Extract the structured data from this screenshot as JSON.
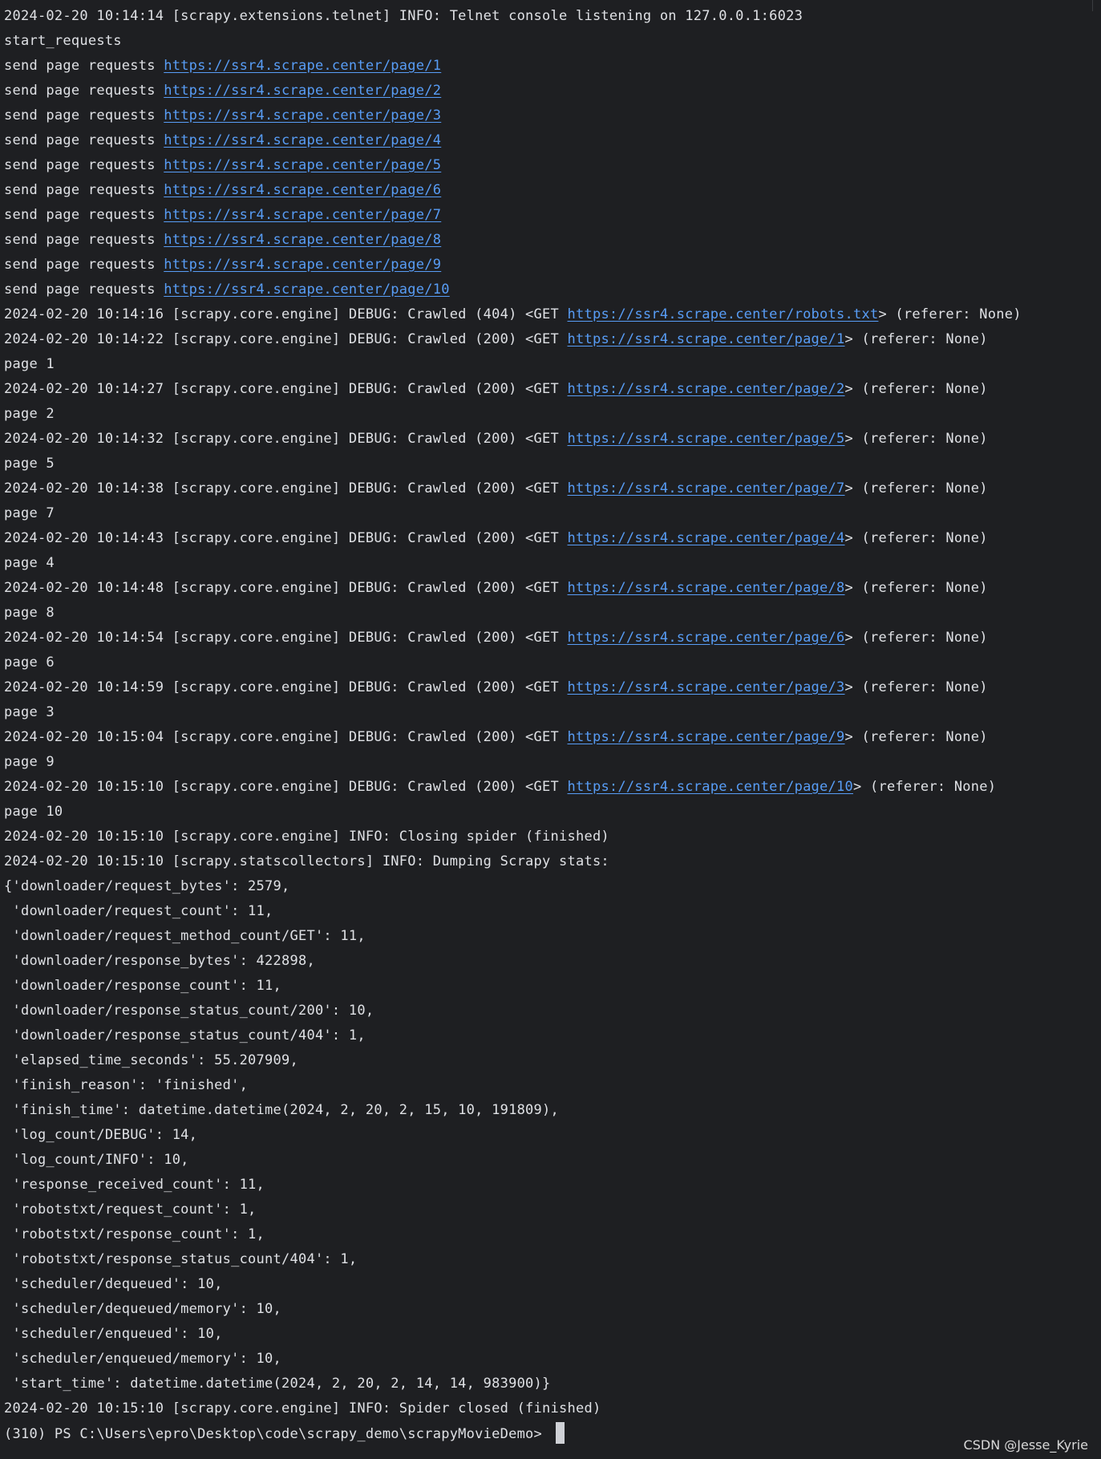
{
  "terminal": {
    "lines": [
      [
        {
          "t": "2024-02-20 10:14:14 [scrapy.extensions.telnet] INFO: Telnet console listening on 127.0.0.1:6023"
        }
      ],
      [
        {
          "t": "start_requests"
        }
      ],
      [
        {
          "t": "send page requests "
        },
        {
          "t": "https://ssr4.scrape.center/page/1",
          "link": true
        }
      ],
      [
        {
          "t": "send page requests "
        },
        {
          "t": "https://ssr4.scrape.center/page/2",
          "link": true
        }
      ],
      [
        {
          "t": "send page requests "
        },
        {
          "t": "https://ssr4.scrape.center/page/3",
          "link": true
        }
      ],
      [
        {
          "t": "send page requests "
        },
        {
          "t": "https://ssr4.scrape.center/page/4",
          "link": true
        }
      ],
      [
        {
          "t": "send page requests "
        },
        {
          "t": "https://ssr4.scrape.center/page/5",
          "link": true
        }
      ],
      [
        {
          "t": "send page requests "
        },
        {
          "t": "https://ssr4.scrape.center/page/6",
          "link": true
        }
      ],
      [
        {
          "t": "send page requests "
        },
        {
          "t": "https://ssr4.scrape.center/page/7",
          "link": true
        }
      ],
      [
        {
          "t": "send page requests "
        },
        {
          "t": "https://ssr4.scrape.center/page/8",
          "link": true
        }
      ],
      [
        {
          "t": "send page requests "
        },
        {
          "t": "https://ssr4.scrape.center/page/9",
          "link": true
        }
      ],
      [
        {
          "t": "send page requests "
        },
        {
          "t": "https://ssr4.scrape.center/page/10",
          "link": true
        }
      ],
      [
        {
          "t": "2024-02-20 10:14:16 [scrapy.core.engine] DEBUG: Crawled (404) <GET "
        },
        {
          "t": "https://ssr4.scrape.center/robots.txt",
          "link": true
        },
        {
          "t": "> (referer: None)"
        }
      ],
      [
        {
          "t": "2024-02-20 10:14:22 [scrapy.core.engine] DEBUG: Crawled (200) <GET "
        },
        {
          "t": "https://ssr4.scrape.center/page/1",
          "link": true
        },
        {
          "t": "> (referer: None)"
        }
      ],
      [
        {
          "t": "page 1"
        }
      ],
      [
        {
          "t": "2024-02-20 10:14:27 [scrapy.core.engine] DEBUG: Crawled (200) <GET "
        },
        {
          "t": "https://ssr4.scrape.center/page/2",
          "link": true
        },
        {
          "t": "> (referer: None)"
        }
      ],
      [
        {
          "t": "page 2"
        }
      ],
      [
        {
          "t": "2024-02-20 10:14:32 [scrapy.core.engine] DEBUG: Crawled (200) <GET "
        },
        {
          "t": "https://ssr4.scrape.center/page/5",
          "link": true
        },
        {
          "t": "> (referer: None)"
        }
      ],
      [
        {
          "t": "page 5"
        }
      ],
      [
        {
          "t": "2024-02-20 10:14:38 [scrapy.core.engine] DEBUG: Crawled (200) <GET "
        },
        {
          "t": "https://ssr4.scrape.center/page/7",
          "link": true
        },
        {
          "t": "> (referer: None)"
        }
      ],
      [
        {
          "t": "page 7"
        }
      ],
      [
        {
          "t": "2024-02-20 10:14:43 [scrapy.core.engine] DEBUG: Crawled (200) <GET "
        },
        {
          "t": "https://ssr4.scrape.center/page/4",
          "link": true
        },
        {
          "t": "> (referer: None)"
        }
      ],
      [
        {
          "t": "page 4"
        }
      ],
      [
        {
          "t": "2024-02-20 10:14:48 [scrapy.core.engine] DEBUG: Crawled (200) <GET "
        },
        {
          "t": "https://ssr4.scrape.center/page/8",
          "link": true
        },
        {
          "t": "> (referer: None)"
        }
      ],
      [
        {
          "t": "page 8"
        }
      ],
      [
        {
          "t": "2024-02-20 10:14:54 [scrapy.core.engine] DEBUG: Crawled (200) <GET "
        },
        {
          "t": "https://ssr4.scrape.center/page/6",
          "link": true
        },
        {
          "t": "> (referer: None)"
        }
      ],
      [
        {
          "t": "page 6"
        }
      ],
      [
        {
          "t": "2024-02-20 10:14:59 [scrapy.core.engine] DEBUG: Crawled (200) <GET "
        },
        {
          "t": "https://ssr4.scrape.center/page/3",
          "link": true
        },
        {
          "t": "> (referer: None)"
        }
      ],
      [
        {
          "t": "page 3"
        }
      ],
      [
        {
          "t": "2024-02-20 10:15:04 [scrapy.core.engine] DEBUG: Crawled (200) <GET "
        },
        {
          "t": "https://ssr4.scrape.center/page/9",
          "link": true
        },
        {
          "t": "> (referer: None)"
        }
      ],
      [
        {
          "t": "page 9"
        }
      ],
      [
        {
          "t": "2024-02-20 10:15:10 [scrapy.core.engine] DEBUG: Crawled (200) <GET "
        },
        {
          "t": "https://ssr4.scrape.center/page/10",
          "link": true
        },
        {
          "t": "> (referer: None)"
        }
      ],
      [
        {
          "t": "page 10"
        }
      ],
      [
        {
          "t": "2024-02-20 10:15:10 [scrapy.core.engine] INFO: Closing spider (finished)"
        }
      ],
      [
        {
          "t": "2024-02-20 10:15:10 [scrapy.statscollectors] INFO: Dumping Scrapy stats:"
        }
      ],
      [
        {
          "t": "{'downloader/request_bytes': 2579,"
        }
      ],
      [
        {
          "t": " 'downloader/request_count': 11,"
        }
      ],
      [
        {
          "t": " 'downloader/request_method_count/GET': 11,"
        }
      ],
      [
        {
          "t": " 'downloader/response_bytes': 422898,"
        }
      ],
      [
        {
          "t": " 'downloader/response_count': 11,"
        }
      ],
      [
        {
          "t": " 'downloader/response_status_count/200': 10,"
        }
      ],
      [
        {
          "t": " 'downloader/response_status_count/404': 1,"
        }
      ],
      [
        {
          "t": " 'elapsed_time_seconds': 55.207909,"
        }
      ],
      [
        {
          "t": " 'finish_reason': 'finished',"
        }
      ],
      [
        {
          "t": " 'finish_time': datetime.datetime(2024, 2, 20, 2, 15, 10, 191809),"
        }
      ],
      [
        {
          "t": " 'log_count/DEBUG': 14,"
        }
      ],
      [
        {
          "t": " 'log_count/INFO': 10,"
        }
      ],
      [
        {
          "t": " 'response_received_count': 11,"
        }
      ],
      [
        {
          "t": " 'robotstxt/request_count': 1,"
        }
      ],
      [
        {
          "t": " 'robotstxt/response_count': 1,"
        }
      ],
      [
        {
          "t": " 'robotstxt/response_status_count/404': 1,"
        }
      ],
      [
        {
          "t": " 'scheduler/dequeued': 10,"
        }
      ],
      [
        {
          "t": " 'scheduler/dequeued/memory': 10,"
        }
      ],
      [
        {
          "t": " 'scheduler/enqueued': 10,"
        }
      ],
      [
        {
          "t": " 'scheduler/enqueued/memory': 10,"
        }
      ],
      [
        {
          "t": " 'start_time': datetime.datetime(2024, 2, 20, 2, 14, 14, 983900)}"
        }
      ],
      [
        {
          "t": "2024-02-20 10:15:10 [scrapy.core.engine] INFO: Spider closed (finished)"
        }
      ]
    ],
    "prompt": "(310) PS C:\\Users\\epro\\Desktop\\code\\scrapy_demo\\scrapyMovieDemo> "
  },
  "watermark": "CSDN @Jesse_Kyrie",
  "colors": {
    "background": "#1e1f22",
    "text": "#dfe1e5",
    "link": "#589df6"
  }
}
